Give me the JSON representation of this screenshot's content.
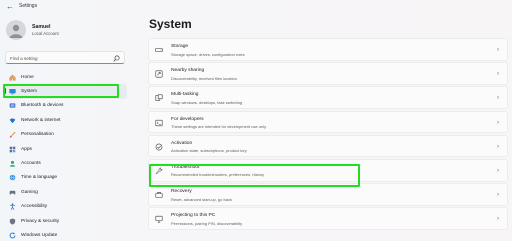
{
  "window": {
    "title": "Settings",
    "back": "←"
  },
  "user": {
    "name": "Samuel",
    "account": "Local Account"
  },
  "search": {
    "placeholder": "Find a setting"
  },
  "sidebar": {
    "items": [
      {
        "label": "Home",
        "icon": "home-icon"
      },
      {
        "label": "System",
        "icon": "system-icon",
        "selected": true
      },
      {
        "label": "Bluetooth & devices",
        "icon": "bluetooth-icon"
      },
      {
        "label": "Network & internet",
        "icon": "wifi-icon"
      },
      {
        "label": "Personalisation",
        "icon": "brush-icon"
      },
      {
        "label": "Apps",
        "icon": "apps-icon"
      },
      {
        "label": "Accounts",
        "icon": "accounts-icon"
      },
      {
        "label": "Time & language",
        "icon": "globe-icon"
      },
      {
        "label": "Gaming",
        "icon": "gamepad-icon"
      },
      {
        "label": "Accessibility",
        "icon": "accessibility-icon"
      },
      {
        "label": "Privacy & security",
        "icon": "shield-icon"
      },
      {
        "label": "Windows Update",
        "icon": "update-icon"
      }
    ]
  },
  "main": {
    "title": "System",
    "cards": [
      {
        "title": "Storage",
        "desc": "Storage space, drives, configuration rules",
        "icon": "storage-icon"
      },
      {
        "title": "Nearby sharing",
        "desc": "Discoverability, received files location",
        "icon": "nearby-sharing-icon"
      },
      {
        "title": "Multi-tasking",
        "desc": "Snap windows, desktops, task switching",
        "icon": "multitasking-icon"
      },
      {
        "title": "For developers",
        "desc": "These settings are intended for development use only",
        "icon": "developer-icon"
      },
      {
        "title": "Activation",
        "desc": "Activation state, subscriptions, product key",
        "icon": "activation-icon"
      },
      {
        "title": "Troubleshoot",
        "desc": "Recommended troubleshooters, preferences, history",
        "icon": "wrench-icon"
      },
      {
        "title": "Recovery",
        "desc": "Reset, advanced start-up, go back",
        "icon": "recovery-icon"
      },
      {
        "title": "Projecting to this PC",
        "desc": "Permissions, pairing PIN, discoverability",
        "icon": "projecting-icon"
      }
    ],
    "chevron": "›"
  },
  "colors": {
    "accent": "#0067c0",
    "highlight": "#22dd22"
  }
}
